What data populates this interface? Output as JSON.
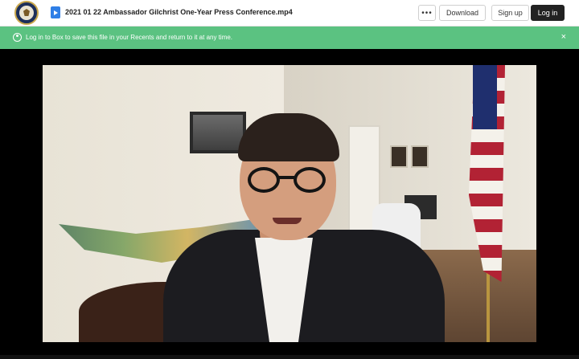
{
  "header": {
    "logo": "state-department-seal",
    "file_icon": "video-file-icon",
    "file_title": "2021 01 22 Ambassador Gilchrist One-Year Press Conference.mp4",
    "more_label": "•••",
    "download_label": "Download",
    "signup_label": "Sign up",
    "login_label": "Log in"
  },
  "banner": {
    "icon": "user-circle-icon",
    "text": "Log in to Box to save this file in your Recents and return to it at any time.",
    "close_label": "×",
    "color": "#5bc281"
  },
  "video": {
    "content": "video-frame"
  }
}
